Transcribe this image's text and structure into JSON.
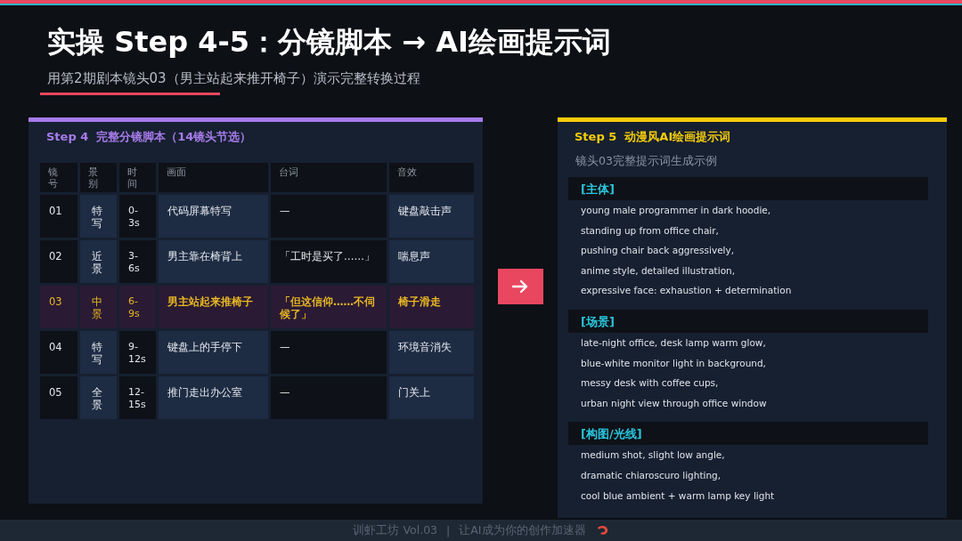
{
  "title": "实操 Step 4-5：分镜脚本 → AI绘画提示词",
  "subtitle": "用第2期剧本镜头03（男主站起来推开椅子）演示完整转换过程",
  "left_panel": {
    "step": "Step 4",
    "title": "完整分镜脚本（14镜头节选）",
    "table": {
      "columns": [
        "镜号",
        "景别",
        "时间",
        "画面",
        "台词",
        "音效"
      ],
      "rows": [
        {
          "selected": false,
          "cells": [
            "01",
            "特写",
            "0-3s",
            "代码屏幕特写",
            "—",
            "键盘敲击声"
          ]
        },
        {
          "selected": false,
          "cells": [
            "02",
            "近景",
            "3-6s",
            "男主靠在椅背上",
            "「工时是买了……」",
            "喘息声"
          ]
        },
        {
          "selected": true,
          "cells": [
            "03",
            "中景",
            "6-9s",
            "男主站起来推椅子",
            "「但这信仰……不伺候了」",
            "椅子滑走"
          ]
        },
        {
          "selected": false,
          "cells": [
            "04",
            "特写",
            "9-12s",
            "键盘上的手停下",
            "—",
            "环境音消失"
          ]
        },
        {
          "selected": false,
          "cells": [
            "05",
            "全景",
            "12-15s",
            "推门走出办公室",
            "—",
            "门关上"
          ]
        }
      ]
    }
  },
  "right_panel": {
    "step": "Step 5",
    "title": "动漫风AI绘画提示词",
    "subtitle": "镜头03完整提示词生成示例",
    "sections": [
      {
        "heading": "[主体]",
        "lines": [
          "young male programmer in dark hoodie,",
          "standing up from office chair,",
          "pushing chair back aggressively,",
          "anime style, detailed illustration,",
          "expressive face: exhaustion + determination"
        ]
      },
      {
        "heading": "[场景]",
        "lines": [
          "late-night office, desk lamp warm glow,",
          "blue-white monitor light in background,",
          "messy desk with coffee cups,",
          "urban night view through office window"
        ]
      },
      {
        "heading": "[构图/光线]",
        "lines": [
          "medium shot, slight low angle,",
          "dramatic chiaroscuro lighting,",
          "cool blue ambient + warm lamp key light"
        ]
      }
    ]
  },
  "footer": {
    "brand": "训虾工坊 Vol.03",
    "separator": "|",
    "slogan": "让AI成为你的创作加速器"
  }
}
